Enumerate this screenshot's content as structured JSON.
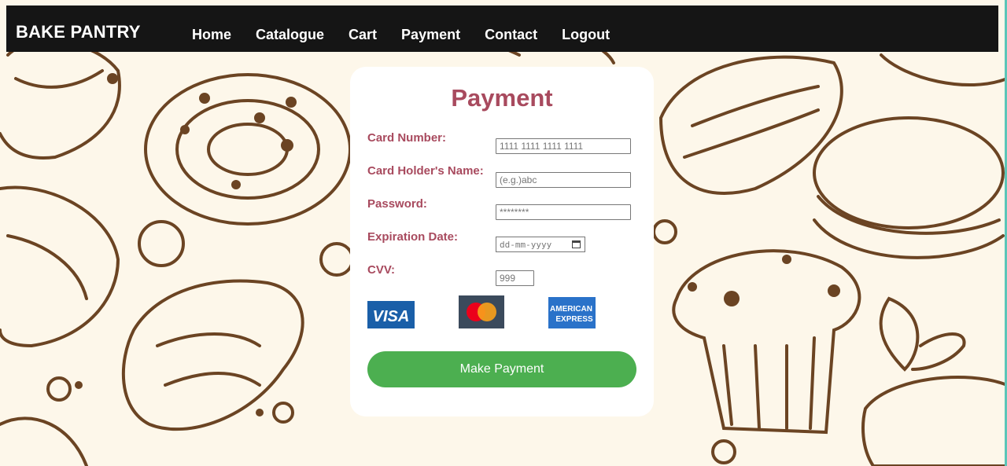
{
  "brand": {
    "name": "BAKE PANTRY"
  },
  "nav": {
    "items": [
      {
        "label": "Home"
      },
      {
        "label": "Catalogue"
      },
      {
        "label": "Cart"
      },
      {
        "label": "Payment"
      },
      {
        "label": "Contact"
      },
      {
        "label": "Logout"
      }
    ]
  },
  "payment": {
    "title": "Payment",
    "fields": {
      "card_number": {
        "label": "Card Number:",
        "placeholder": "1111 1111 1111 1111"
      },
      "holder_name": {
        "label": "Card Holder's Name:",
        "placeholder": "(e.g.)abc"
      },
      "password": {
        "label": "Password:",
        "placeholder": "********"
      },
      "expiration": {
        "label": "Expiration Date:",
        "placeholder": "dd-mm-yyyy"
      },
      "cvv": {
        "label": "CVV:",
        "placeholder": "999"
      }
    },
    "card_logos": [
      {
        "name": "visa-logo",
        "text": "VISA"
      },
      {
        "name": "mastercard-logo"
      },
      {
        "name": "american-express-logo",
        "line1": "AMERICAN",
        "line2": "EXPRESS"
      }
    ],
    "submit_label": "Make Payment"
  },
  "colors": {
    "accent": "#a84a5e",
    "button": "#4caf50",
    "navbar": "#151515",
    "background": "#fdf7ea",
    "illustration": "#6b4423"
  }
}
